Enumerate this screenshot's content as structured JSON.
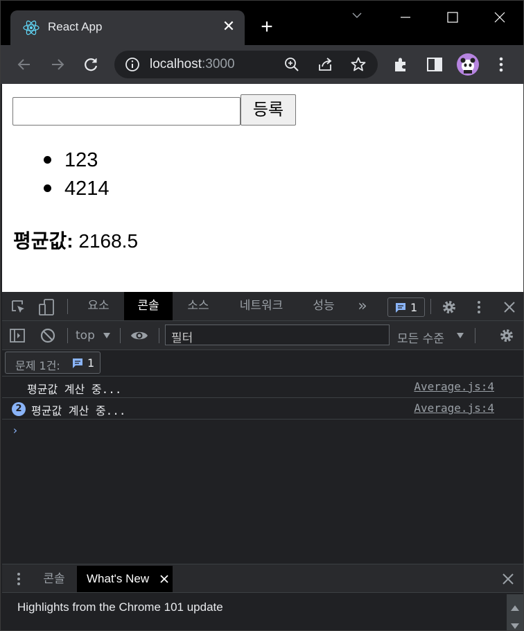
{
  "browser": {
    "tab_title": "React App",
    "url_host": "localhost",
    "url_port": ":3000",
    "new_tab_symbol": "+",
    "tab_close_symbol": "✕"
  },
  "page": {
    "input_value": "",
    "register_button": "등록",
    "items": [
      "123",
      "4214"
    ],
    "average_label": "평균값:",
    "average_value": "2168.5"
  },
  "devtools": {
    "tabs": [
      "요소",
      "콘솔",
      "소스",
      "네트워크",
      "성능"
    ],
    "active_tab": "콘솔",
    "more_tabs": "»",
    "issue_count": "1",
    "context": "top",
    "filter_placeholder": "필터",
    "levels": "모든 수준",
    "issues_label": "문제 1건:",
    "issues_count": "1",
    "console_rows": [
      {
        "count": "",
        "message": "평균값 계산 중...",
        "source": "Average.js:4"
      },
      {
        "count": "2",
        "message": "평균값 계산 중...",
        "source": "Average.js:4"
      }
    ],
    "prompt": "›",
    "drawer_tabs": [
      "콘솔",
      "What's New"
    ],
    "drawer_active": "What's New",
    "whats_new_text": "Highlights from the Chrome 101 update"
  },
  "colors": {
    "devtools_bg": "#202124",
    "toolbar_bg": "#35363a",
    "accent_blue": "#8ab4f8",
    "avatar": "#b684e0"
  },
  "icons": [
    "react-icon",
    "back-icon",
    "forward-icon",
    "reload-icon",
    "info-icon",
    "zoom-icon",
    "share-icon",
    "star-icon",
    "extensions-icon",
    "sidepanel-icon",
    "menu-icon",
    "inspect-icon",
    "device-icon",
    "gear-icon",
    "close-icon",
    "block-icon",
    "eye-icon"
  ]
}
